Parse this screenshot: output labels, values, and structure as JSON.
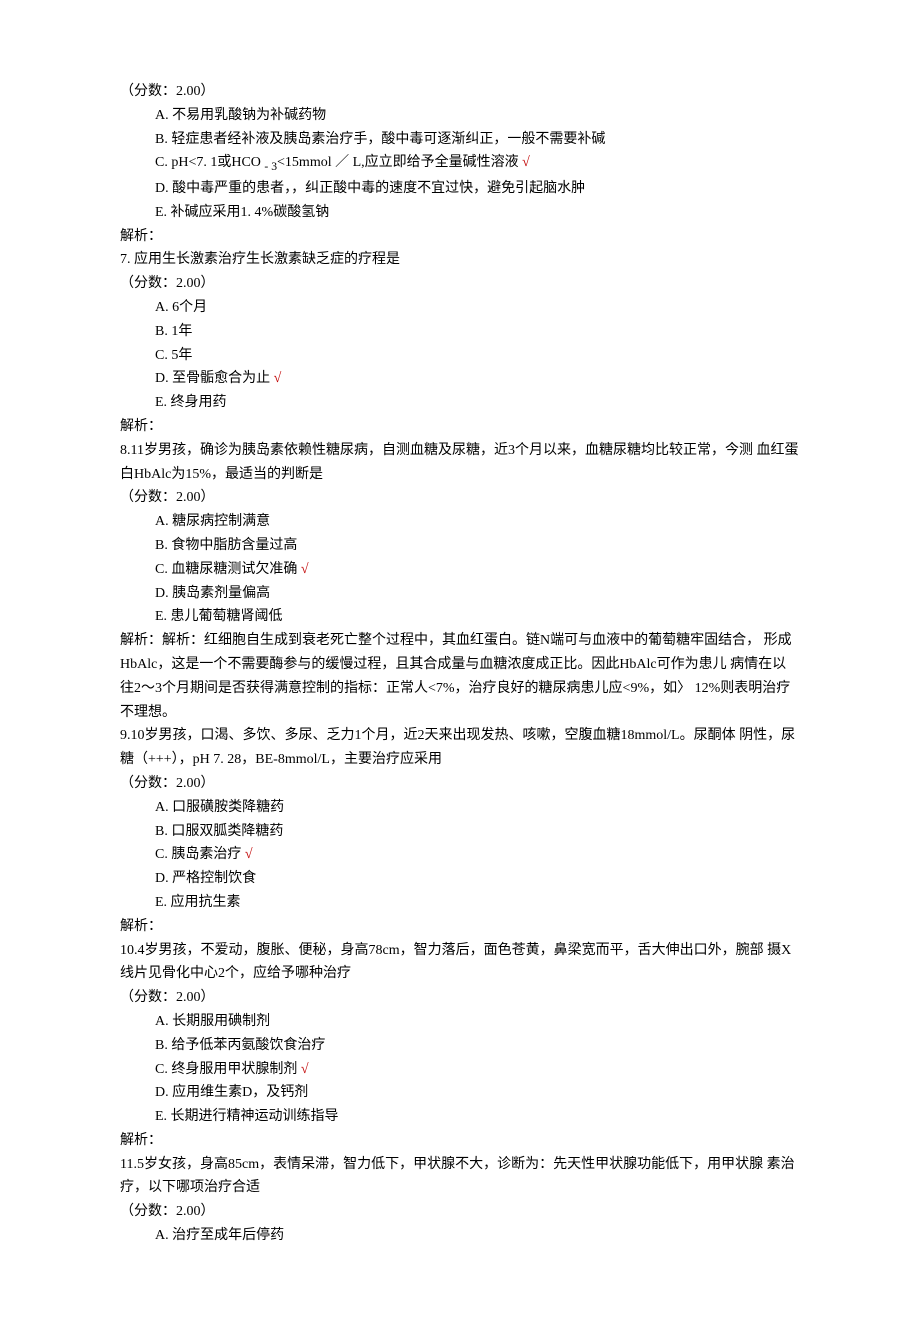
{
  "q6": {
    "score": "（分数：2.00）",
    "opts": {
      "a": "　A. 不易用乳酸钠为补碱药物",
      "b": "　B. 轻症患者经补液及胰岛素治疗手，酸中毒可逐渐纠正，一般不需要补碱",
      "c_pre": "　C. pH<7. 1或HCO ",
      "c_sub": "- 3",
      "c_post": "<15mmol ／ L,应立即给予全量碱性溶液 ",
      "c_mark": "√",
      "d": "　D. 酸中毒严重的患者，，纠正酸中毒的速度不宜过快，避免引起脑水肿",
      "e": "　E. 补碱应采用1. 4%碳酸氢钠"
    },
    "analysis": "解析："
  },
  "q7": {
    "stem": "7. 应用生长激素治疗生长激素缺乏症的疗程是",
    "score": "（分数：2.00）",
    "opts": {
      "a": "　A. 6个月",
      "b": "　B. 1年",
      "c": "　C. 5年",
      "d_pre": "　D. 至骨骺愈合为止 ",
      "d_mark": "√",
      "e": "　E. 终身用药"
    },
    "analysis": "解析："
  },
  "q8": {
    "stem": "8.11岁男孩，确诊为胰岛素依赖性糖尿病，自测血糖及尿糖，近3个月以来，血糖尿糖均比较正常，今测 血红蛋白HbAlc为15%，最适当的判断是",
    "score": "（分数：2.00）",
    "opts": {
      "a": "　A. 糖尿病控制满意",
      "b": "　B. 食物中脂肪含量过高",
      "c_pre": "　C. 血糖尿糖测试欠准确 ",
      "c_mark": "√",
      "d": "　D. 胰岛素剂量偏高",
      "e": "　E. 患儿葡萄糖肾阈低"
    },
    "analysis": "解析：解析：红细胞自生成到衰老死亡整个过程中，其血红蛋白。链N端可与血液中的葡萄糖牢固结合， 形成HbAlc，这是一个不需要酶参与的缓慢过程，且其合成量与血糖浓度成正比。因此HbAlc可作为患儿 病情在以往2〜3个月期间是否获得满意控制的指标：正常人<7%，治疗良好的糖尿病患儿应<9%，如〉 12%则表明治疗不理想。"
  },
  "q9": {
    "stem": "9.10岁男孩，口渴、多饮、多尿、乏力1个月，近2天来出现发热、咳嗽，空腹血糖18mmol/L。尿酮体 阴性，尿糖（+++），pH 7. 28，BE-8mmol/L，主要治疗应采用",
    "score": "（分数：2.00）",
    "opts": {
      "a": "　A. 口服磺胺类降糖药",
      "b": "　B. 口服双胍类降糖药",
      "c_pre": "　C. 胰岛素治疗 ",
      "c_mark": "√",
      "d": "　D. 严格控制饮食",
      "e": "　E. 应用抗生素"
    },
    "analysis": "解析："
  },
  "q10": {
    "stem": "10.4岁男孩，不爱动，腹胀、便秘，身高78cm，智力落后，面色苍黄，鼻梁宽而平，舌大伸出口外，腕部 摄X线片见骨化中心2个，应给予哪种治疗",
    "score": "（分数：2.00）",
    "opts": {
      "a": "　A. 长期服用碘制剂",
      "b": "　B. 给予低苯丙氨酸饮食治疗",
      "c_pre": "　C. 终身服用甲状腺制剂 ",
      "c_mark": "√",
      "d": "　D. 应用维生素D，及钙剂",
      "e": "　E. 长期进行精神运动训练指导"
    },
    "analysis": "解析："
  },
  "q11": {
    "stem": "11.5岁女孩，身高85cm，表情呆滞，智力低下，甲状腺不大，诊断为：先天性甲状腺功能低下，用甲状腺 素治疗，以下哪项治疗合适",
    "score": "（分数：2.00）",
    "opts": {
      "a": "　A. 治疗至成年后停药"
    }
  }
}
